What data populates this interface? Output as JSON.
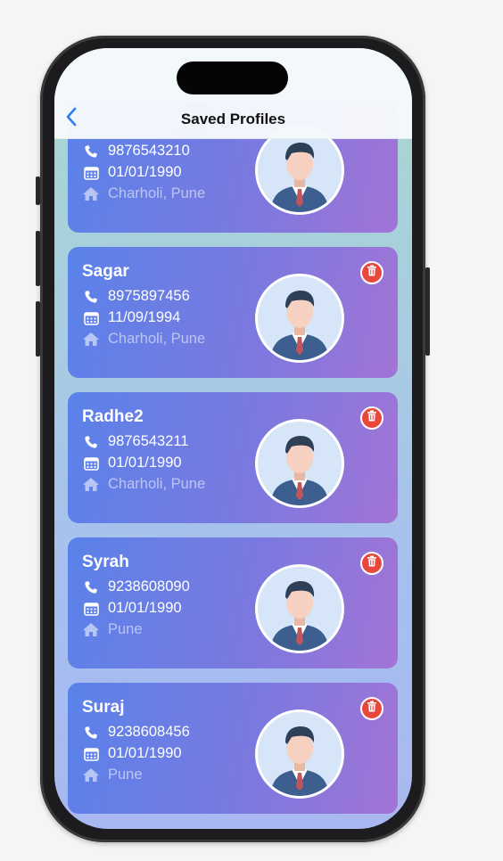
{
  "nav": {
    "title": "Saved Profiles",
    "back_icon": "chevron-left-icon"
  },
  "colors": {
    "accent": "#2f7cf6",
    "card_gradient_start": "#5a82ea",
    "card_gradient_end": "#a274d6",
    "delete": "#e8473e"
  },
  "profiles": [
    {
      "name": "",
      "phone": "9876543210",
      "dob": "01/01/1990",
      "address": "Charholi, Pune"
    },
    {
      "name": "Sagar",
      "phone": "8975897456",
      "dob": "11/09/1994",
      "address": "Charholi, Pune"
    },
    {
      "name": "Radhe2",
      "phone": "9876543211",
      "dob": "01/01/1990",
      "address": "Charholi, Pune"
    },
    {
      "name": "Syrah",
      "phone": "9238608090",
      "dob": "01/01/1990",
      "address": "Pune"
    },
    {
      "name": "Suraj",
      "phone": "9238608456",
      "dob": "01/01/1990",
      "address": "Pune"
    }
  ]
}
